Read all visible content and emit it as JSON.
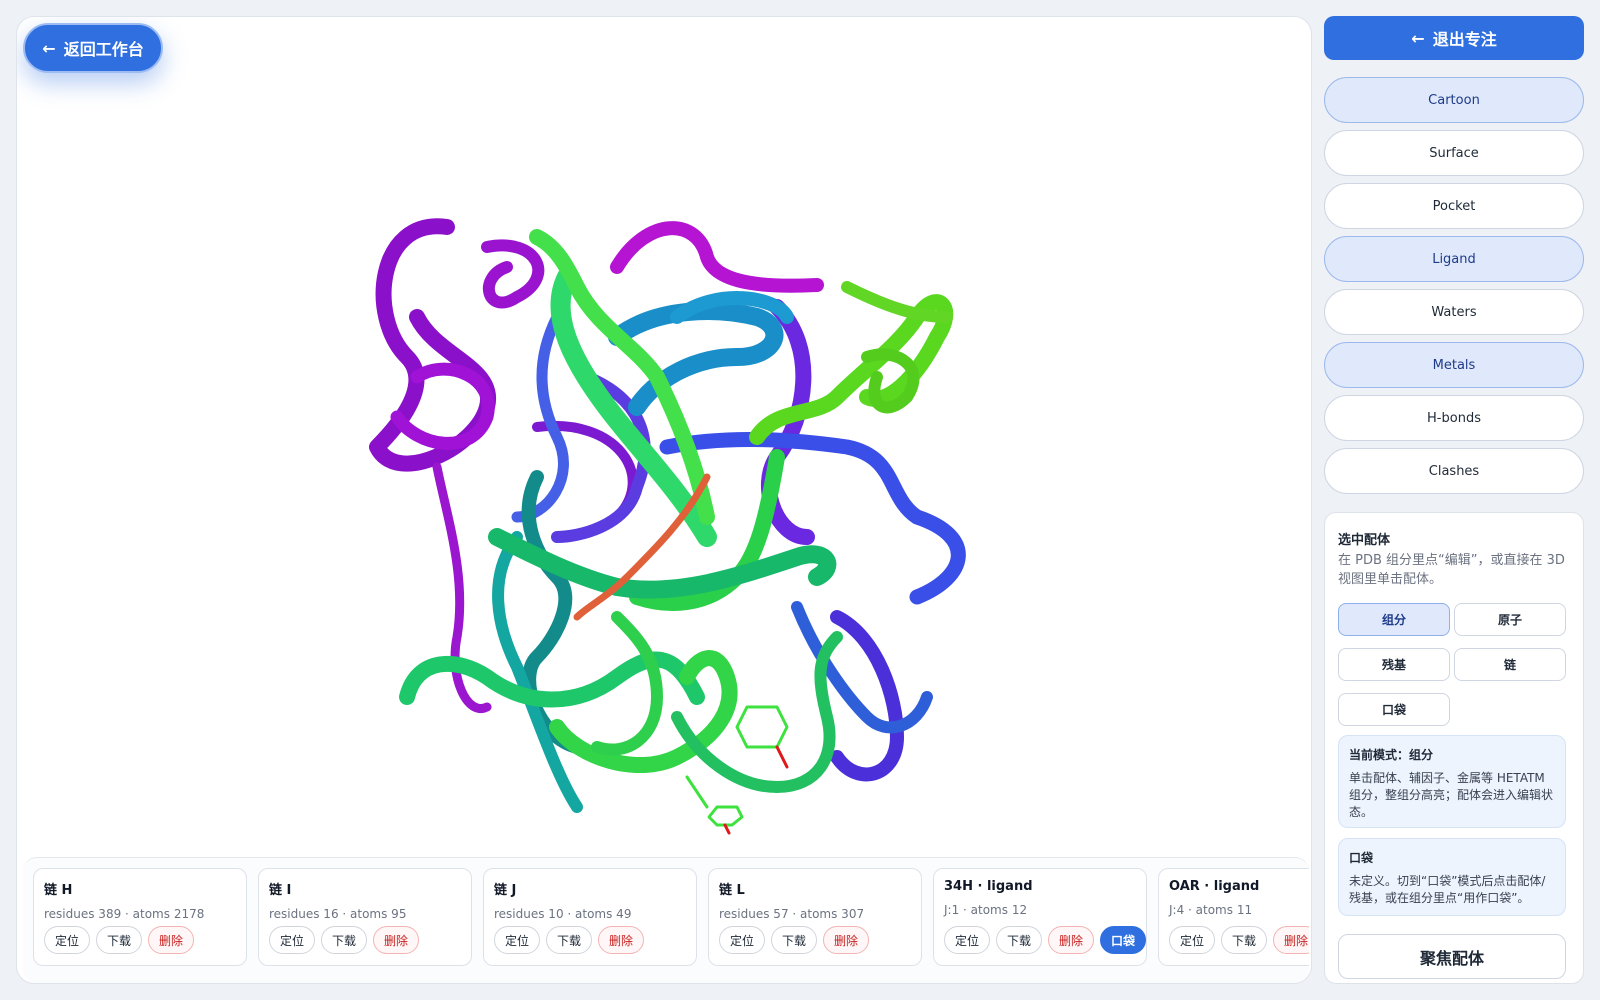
{
  "viewer": {
    "back_label": "返回工作台"
  },
  "chains": [
    {
      "title": "链 H",
      "stats": "residues 389 · atoms 2178",
      "buttons": [
        "定位",
        "下载",
        "删除"
      ]
    },
    {
      "title": "链 I",
      "stats": "residues 16 · atoms 95",
      "buttons": [
        "定位",
        "下载",
        "删除"
      ]
    },
    {
      "title": "链 J",
      "stats": "residues 10 · atoms 49",
      "buttons": [
        "定位",
        "下载",
        "删除"
      ]
    },
    {
      "title": "链 L",
      "stats": "residues 57 · atoms 307",
      "buttons": [
        "定位",
        "下载",
        "删除"
      ]
    },
    {
      "title": "34H · ligand",
      "stats": "J:1 · atoms 12",
      "buttons": [
        "定位",
        "下载",
        "删除",
        "口袋"
      ]
    },
    {
      "title": "OAR · ligand",
      "stats": "J:4 · atoms 11",
      "buttons": [
        "定位",
        "下载",
        "删除"
      ]
    }
  ],
  "side": {
    "exit_label": "退出专注",
    "view_buttons": [
      {
        "label": "Cartoon",
        "active": true
      },
      {
        "label": "Surface",
        "active": false
      },
      {
        "label": "Pocket",
        "active": false
      },
      {
        "label": "Ligand",
        "active": true
      },
      {
        "label": "Waters",
        "active": false
      },
      {
        "label": "Metals",
        "active": true
      },
      {
        "label": "H-bonds",
        "active": false
      },
      {
        "label": "Clashes",
        "active": false
      }
    ],
    "selection": {
      "title": "选中配体",
      "description": "在 PDB 组分里点“编辑”，或直接在 3D 视图里单击配体。",
      "modes": [
        {
          "label": "组分",
          "active": true
        },
        {
          "label": "原子",
          "active": false
        },
        {
          "label": "残基",
          "active": false
        },
        {
          "label": "链",
          "active": false
        },
        {
          "label": "口袋",
          "active": false
        }
      ],
      "current_mode_title": "当前模式：组分",
      "current_mode_body": "单击配体、辅因子、金属等 HETATM 组分，整组分高亮；配体会进入编辑状态。",
      "pocket_title": "口袋",
      "pocket_body": "未定义。切到“口袋”模式后点击配体/残基，或在组分里点“用作口袋”。",
      "focus_label": "聚焦配体"
    }
  },
  "colors": {
    "accent": "#2f6fe0",
    "active_bg": "#dfe9fb",
    "danger": "#c81e1e"
  }
}
